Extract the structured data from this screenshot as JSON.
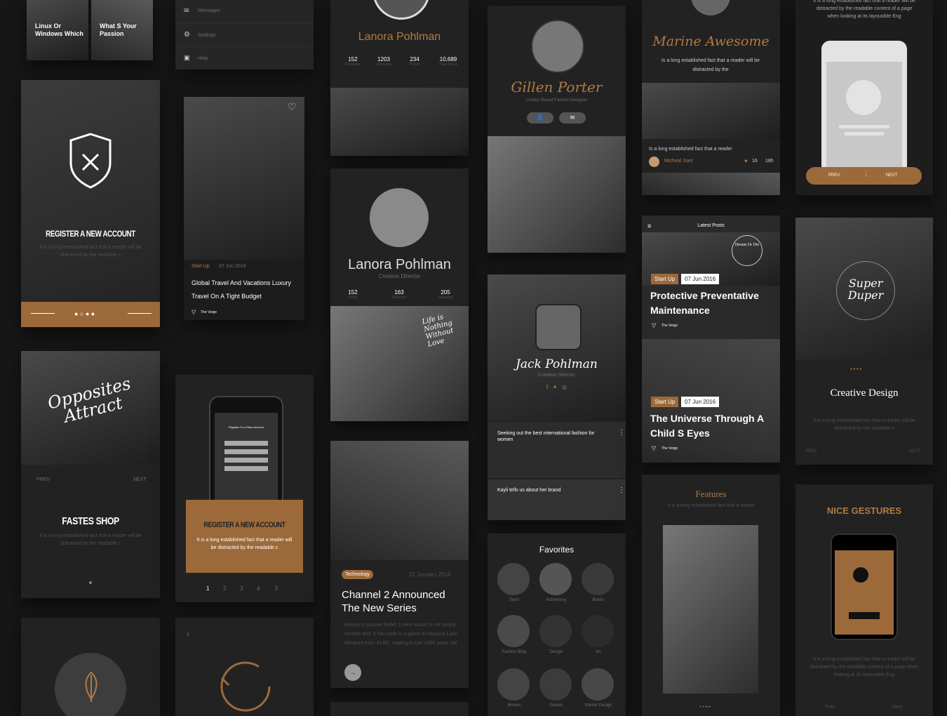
{
  "colors": {
    "accent": "#9c6a3a",
    "accent_text": "#b37a44",
    "bg": "#171717",
    "card": "#222222"
  },
  "top_tiles": {
    "t1": "Linux Or Windows Which",
    "t2": "What S Your Passion"
  },
  "menu": {
    "items": [
      "Messages",
      "Settings",
      "Help"
    ]
  },
  "profile1": {
    "name": "Lanora Pohlman",
    "stats": [
      {
        "v": "152",
        "l": "Followers"
      },
      {
        "v": "1203",
        "l": "Following"
      },
      {
        "v": "234",
        "l": "Photos"
      },
      {
        "v": "10,689",
        "l": "Page Views"
      }
    ]
  },
  "gillen": {
    "name": "Gillen Porter",
    "subtitle": "London Based Fashion Designer"
  },
  "marine": {
    "name": "Marine Awesome",
    "desc": "Is a long established fact that a reader will be distracted by the",
    "caption": "Is a long established fact that a reader",
    "author": "Micheal Joez",
    "likes": "16",
    "time": "18h"
  },
  "onboard": {
    "prev": "PREV",
    "next": "NEXT",
    "text": "It is a long established fact that a reader will be distracted by the readable content of a page when looking at its layousible Eng"
  },
  "register": {
    "title": "REGISTER A NEW ACCOUNT",
    "desc": "It is a long established fact that a reader will be distracted by the readable c"
  },
  "travel": {
    "tag": "Start Up",
    "date": "07 Jun 2016",
    "title": "Global Travel And Vacations Luxury Travel On A Tight Budget",
    "source": "The Verge"
  },
  "profile2": {
    "name": "Lanora Pohlman",
    "role": "Creative Director",
    "stats": [
      {
        "v": "152",
        "l": "Posts"
      },
      {
        "v": "163",
        "l": "Followers"
      },
      {
        "v": "205",
        "l": "Following"
      }
    ]
  },
  "jack": {
    "name": "Jack Pohlman",
    "role": "Creative Director",
    "item1": "Seeking out the best international fashion for women",
    "item2": "Kayli tells us about her brand"
  },
  "posts": {
    "header": "Latest Posts",
    "p1": {
      "tag": "Start Up",
      "date": "07 Jun 2016",
      "title": "Protective Preventative Maintenance",
      "source": "The Verge"
    },
    "p2": {
      "tag": "Start Up",
      "date": "07 Jun 2016",
      "title": "The Universe Through A Child S Eyes",
      "source": "The Verge"
    }
  },
  "creative": {
    "title": "Creative Design",
    "desc": "It is a long established fact that a reader will be distracted by the readable c",
    "prev": "PREV",
    "next": "NEXT"
  },
  "shop": {
    "prev": "PREV",
    "next": "NEXT",
    "title": "FASTES SHOP",
    "desc": "It is a long established fact that a reader will be distracted by the readable c"
  },
  "register2": {
    "title": "REGISTER A NEW ACCOUNT",
    "desc": "It is a long established fact that a reader will be distracted by the readable c",
    "phone_title": "Register For A New Account",
    "pages": [
      "1",
      "2",
      "3",
      "4",
      "5"
    ]
  },
  "article": {
    "tag": "Technology",
    "date": "22 January 2016",
    "title": "Channel 2 Announced The New Series",
    "body": "ontrary to popular belief, Lorem Ipsum is not simply random text. It has roots in a piece of classical Latin literature from 45 BC, making it over 2000 years old."
  },
  "favorites": {
    "title": "Favorites",
    "items": [
      "Sport",
      "Astronomy",
      "Books",
      "Fashion Blog",
      "Design",
      "Art",
      "Movies",
      "Games",
      "Interior Design"
    ]
  },
  "features": {
    "title": "Features",
    "desc": "It is a long established fact that a reader"
  },
  "gestures": {
    "title": "NICE GESTURES",
    "desc": "It is a long established fact that a reader will be distracted by the readable content of a page when looking at its layousible Eng",
    "prev": "Prev",
    "next": "Next"
  },
  "logos": {
    "opposites": "Opposites Attract",
    "super": "Super Duper",
    "dream": "Dream Or Die",
    "life": "Life is Nothing Without Love"
  }
}
